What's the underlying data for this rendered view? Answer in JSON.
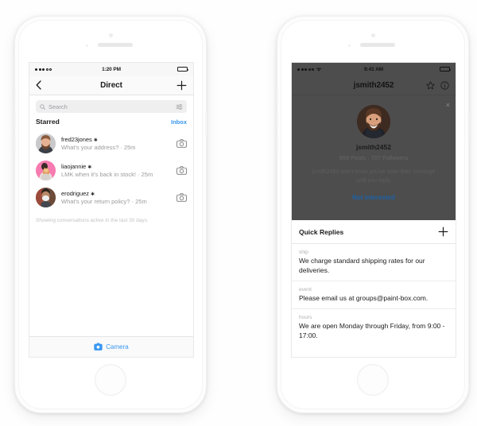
{
  "theme": {
    "accent_blue": "#3897f0",
    "link_blue": "#1d62a7",
    "overlay_dark": "#4d4d4d",
    "text_dark": "#1c1c1c",
    "text_muted": "#9b9b9b",
    "page_bg": "#fefefe"
  },
  "left_phone": {
    "status_bar": {
      "time": "1:20 PM",
      "carrier_dots": "•••○○",
      "battery": "full"
    },
    "nav": {
      "back_icon": "chevron-left-icon",
      "title": "Direct",
      "add_icon": "plus-icon"
    },
    "search": {
      "placeholder": "Search",
      "search_icon": "search-icon",
      "filter_icon": "tune-sliders-icon"
    },
    "section": {
      "title": "Starred",
      "action_label": "Inbox"
    },
    "conversations": [
      {
        "name": "fred23jones",
        "starred_marker": "✱",
        "preview": "What's your address? · 25m",
        "action_icon": "camera-icon",
        "avatar": "man-with-beard-photo"
      },
      {
        "name": "liaojannie",
        "starred_marker": "✱",
        "preview": "LMK when it's back in stock! · 25m",
        "action_icon": "camera-icon",
        "avatar": "person-holding-cat-pink-bg-photo"
      },
      {
        "name": "erodriguez",
        "starred_marker": "✱",
        "preview": "What's your return policy? · 25m",
        "action_icon": "camera-icon",
        "avatar": "person-with-mask-photo"
      }
    ],
    "footnote": "Showing conversations active in the last 30 days.",
    "bottom_bar": {
      "camera_icon": "camera-filled-icon",
      "label": "Camera"
    }
  },
  "right_phone": {
    "status_bar": {
      "time": "9:41 AM",
      "carrier_dots": "•••○○",
      "wifi_icon": "wifi-icon",
      "battery": "full"
    },
    "nav": {
      "title": "jsmith2452",
      "star_icon": "star-outline-icon",
      "info_icon": "info-circle-icon"
    },
    "overlay": {
      "close_icon": "close-x-icon",
      "avatar": "smiling-man-photo",
      "username": "jsmith2452",
      "stats": "999 Posts  ·  707 Followers",
      "note": "jsmith2452 won't know you've seen their message until you reply.",
      "action_label": "Not interested"
    },
    "quick_replies": {
      "title": "Quick Replies",
      "add_icon": "plus-icon",
      "items": [
        {
          "shortcut": "ship",
          "message": "We charge standard shipping rates for our deliveries."
        },
        {
          "shortcut": "event",
          "message": "Please email us at groups@paint-box.com."
        },
        {
          "shortcut": "hours",
          "message": "We are open Monday through Friday, from 9:00 - 17:00."
        }
      ]
    }
  }
}
